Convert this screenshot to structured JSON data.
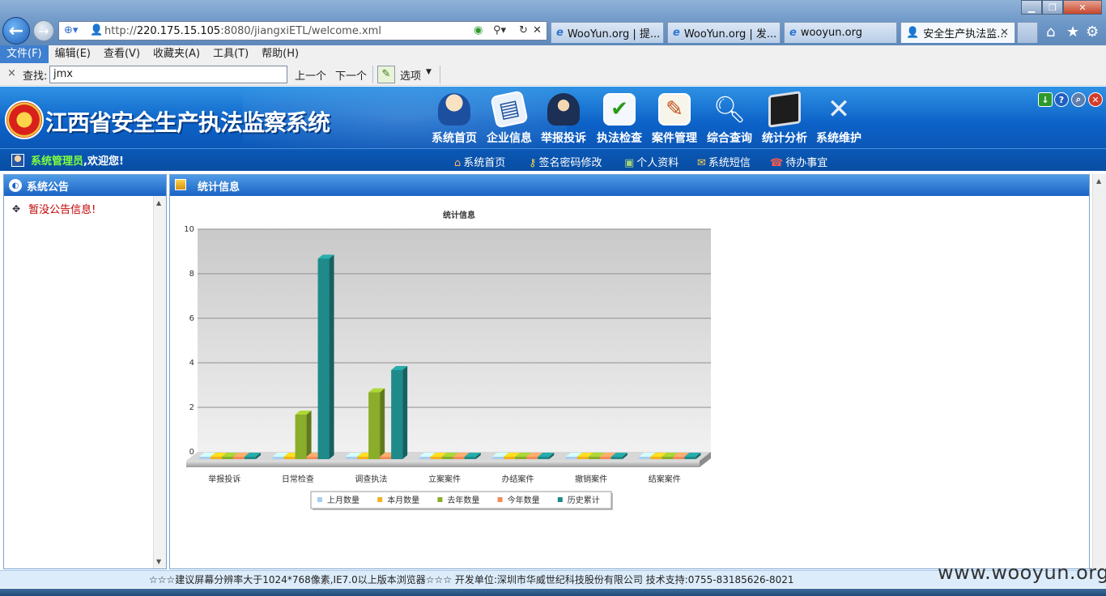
{
  "browser": {
    "url_prefix": "http://",
    "url_host": "220.175.15.105",
    "url_rest": ":8080/jiangxiETL/welcome.xml",
    "tabs": [
      {
        "label": "WooYun.org | 提..."
      },
      {
        "label": "WooYun.org | 发..."
      },
      {
        "label": "wooyun.org"
      },
      {
        "label": "安全生产执法监..."
      }
    ],
    "menu": [
      "文件(F)",
      "编辑(E)",
      "查看(V)",
      "收藏夹(A)",
      "工具(T)",
      "帮助(H)"
    ],
    "find": {
      "close": "×",
      "label": "查找:",
      "value": "jmx",
      "prev": "上一个",
      "next": "下一个",
      "options": "选项"
    }
  },
  "app": {
    "title": "江西省安全生产执法监察系统",
    "nav": [
      {
        "label": "系统首页",
        "icon": "person-icon"
      },
      {
        "label": "企业信息",
        "icon": "document-icon"
      },
      {
        "label": "举报投诉",
        "icon": "officer-icon"
      },
      {
        "label": "执法检查",
        "icon": "checklist-icon"
      },
      {
        "label": "案件管理",
        "icon": "pen-icon"
      },
      {
        "label": "综合查询",
        "icon": "magnifier-icon"
      },
      {
        "label": "统计分析",
        "icon": "monitor-icon"
      },
      {
        "label": "系统维护",
        "icon": "tools-icon"
      }
    ],
    "welcome_user": "系统管理员",
    "welcome_text": ",欢迎您!",
    "sublinks": [
      {
        "label": "系统首页"
      },
      {
        "label": "签名密码修改"
      },
      {
        "label": "个人资料"
      },
      {
        "label": "系统短信"
      },
      {
        "label": "待办事宜"
      }
    ]
  },
  "left_panel": {
    "title": "系统公告",
    "notice": "暂没公告信息!"
  },
  "main_panel": {
    "title": "统计信息"
  },
  "chart_data": {
    "type": "bar",
    "title": "统计信息",
    "categories": [
      "举报投诉",
      "日常检查",
      "调查执法",
      "立案案件",
      "办结案件",
      "撤销案件",
      "结案案件"
    ],
    "series": [
      {
        "name": "上月数量",
        "color": "#a9cdf0",
        "values": [
          0,
          0,
          0,
          0,
          0,
          0,
          0
        ]
      },
      {
        "name": "本月数量",
        "color": "#f2b21b",
        "values": [
          0,
          0,
          0,
          0,
          0,
          0,
          0
        ]
      },
      {
        "name": "去年数量",
        "color": "#8aad2a",
        "values": [
          0,
          2,
          3,
          0,
          0,
          0,
          0
        ]
      },
      {
        "name": "今年数量",
        "color": "#f28c58",
        "values": [
          0,
          0,
          0,
          0,
          0,
          0,
          0
        ]
      },
      {
        "name": "历史累计",
        "color": "#1f8a8a",
        "values": [
          0,
          9,
          4,
          0,
          0,
          0,
          0
        ]
      }
    ],
    "ylim": [
      0,
      10
    ],
    "yticks": [
      "0",
      "2",
      "4",
      "6",
      "8",
      "10"
    ],
    "grid": true,
    "legend": "bottom"
  },
  "footer": {
    "text": "☆☆☆建议屏幕分辨率大于1024*768像素,IE7.0以上版本浏览器☆☆☆  开发单位:深圳市华威世纪科技股份有限公司  技术支持:0755-83185626-8021"
  },
  "watermark": "www.wooyun.org"
}
